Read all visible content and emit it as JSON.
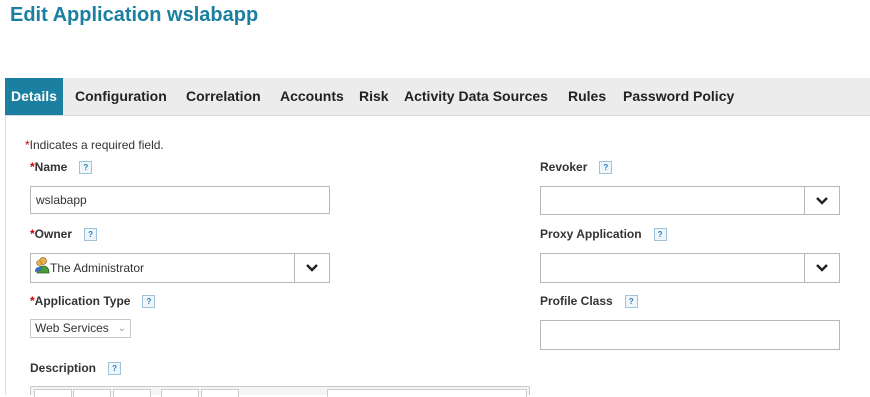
{
  "page": {
    "title": "Edit Application wslabapp"
  },
  "tabs": [
    {
      "label": "Details",
      "active": true
    },
    {
      "label": "Configuration"
    },
    {
      "label": "Correlation"
    },
    {
      "label": "Accounts"
    },
    {
      "label": "Risk"
    },
    {
      "label": "Activity Data Sources"
    },
    {
      "label": "Rules"
    },
    {
      "label": "Password Policy"
    }
  ],
  "form": {
    "required_note": "Indicates a required field.",
    "required_marker": "*",
    "help_glyph": "?",
    "name": {
      "label": "Name",
      "value": "wslabapp"
    },
    "owner": {
      "label": "Owner",
      "value": "The Administrator",
      "icon": "user-icon"
    },
    "application_type": {
      "label": "Application Type",
      "value": "Web Services"
    },
    "description": {
      "label": "Description"
    },
    "revoker": {
      "label": "Revoker",
      "value": ""
    },
    "proxy_application": {
      "label": "Proxy Application",
      "value": ""
    },
    "profile_class": {
      "label": "Profile Class",
      "value": ""
    }
  },
  "colors": {
    "accent": "#1a7fa0",
    "required": "#cc0000"
  }
}
